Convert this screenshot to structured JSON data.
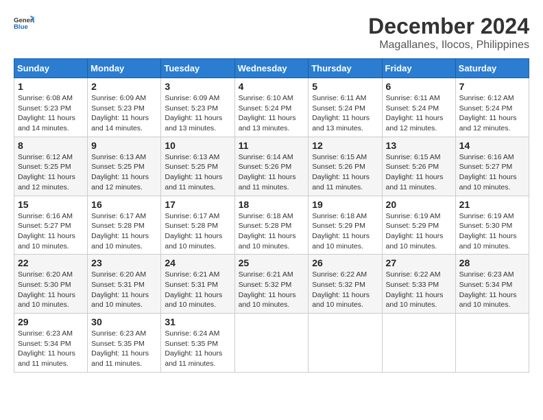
{
  "logo": {
    "text_general": "General",
    "text_blue": "Blue",
    "icon_alt": "GeneralBlue logo"
  },
  "header": {
    "month": "December 2024",
    "location": "Magallanes, Ilocos, Philippines"
  },
  "weekdays": [
    "Sunday",
    "Monday",
    "Tuesday",
    "Wednesday",
    "Thursday",
    "Friday",
    "Saturday"
  ],
  "weeks": [
    [
      {
        "day": 1,
        "sunrise": "Sunrise: 6:08 AM",
        "sunset": "Sunset: 5:23 PM",
        "daylight": "Daylight: 11 hours and 14 minutes."
      },
      {
        "day": 2,
        "sunrise": "Sunrise: 6:09 AM",
        "sunset": "Sunset: 5:23 PM",
        "daylight": "Daylight: 11 hours and 14 minutes."
      },
      {
        "day": 3,
        "sunrise": "Sunrise: 6:09 AM",
        "sunset": "Sunset: 5:23 PM",
        "daylight": "Daylight: 11 hours and 13 minutes."
      },
      {
        "day": 4,
        "sunrise": "Sunrise: 6:10 AM",
        "sunset": "Sunset: 5:24 PM",
        "daylight": "Daylight: 11 hours and 13 minutes."
      },
      {
        "day": 5,
        "sunrise": "Sunrise: 6:11 AM",
        "sunset": "Sunset: 5:24 PM",
        "daylight": "Daylight: 11 hours and 13 minutes."
      },
      {
        "day": 6,
        "sunrise": "Sunrise: 6:11 AM",
        "sunset": "Sunset: 5:24 PM",
        "daylight": "Daylight: 11 hours and 12 minutes."
      },
      {
        "day": 7,
        "sunrise": "Sunrise: 6:12 AM",
        "sunset": "Sunset: 5:24 PM",
        "daylight": "Daylight: 11 hours and 12 minutes."
      }
    ],
    [
      {
        "day": 8,
        "sunrise": "Sunrise: 6:12 AM",
        "sunset": "Sunset: 5:25 PM",
        "daylight": "Daylight: 11 hours and 12 minutes."
      },
      {
        "day": 9,
        "sunrise": "Sunrise: 6:13 AM",
        "sunset": "Sunset: 5:25 PM",
        "daylight": "Daylight: 11 hours and 12 minutes."
      },
      {
        "day": 10,
        "sunrise": "Sunrise: 6:13 AM",
        "sunset": "Sunset: 5:25 PM",
        "daylight": "Daylight: 11 hours and 11 minutes."
      },
      {
        "day": 11,
        "sunrise": "Sunrise: 6:14 AM",
        "sunset": "Sunset: 5:26 PM",
        "daylight": "Daylight: 11 hours and 11 minutes."
      },
      {
        "day": 12,
        "sunrise": "Sunrise: 6:15 AM",
        "sunset": "Sunset: 5:26 PM",
        "daylight": "Daylight: 11 hours and 11 minutes."
      },
      {
        "day": 13,
        "sunrise": "Sunrise: 6:15 AM",
        "sunset": "Sunset: 5:26 PM",
        "daylight": "Daylight: 11 hours and 11 minutes."
      },
      {
        "day": 14,
        "sunrise": "Sunrise: 6:16 AM",
        "sunset": "Sunset: 5:27 PM",
        "daylight": "Daylight: 11 hours and 10 minutes."
      }
    ],
    [
      {
        "day": 15,
        "sunrise": "Sunrise: 6:16 AM",
        "sunset": "Sunset: 5:27 PM",
        "daylight": "Daylight: 11 hours and 10 minutes."
      },
      {
        "day": 16,
        "sunrise": "Sunrise: 6:17 AM",
        "sunset": "Sunset: 5:28 PM",
        "daylight": "Daylight: 11 hours and 10 minutes."
      },
      {
        "day": 17,
        "sunrise": "Sunrise: 6:17 AM",
        "sunset": "Sunset: 5:28 PM",
        "daylight": "Daylight: 11 hours and 10 minutes."
      },
      {
        "day": 18,
        "sunrise": "Sunrise: 6:18 AM",
        "sunset": "Sunset: 5:28 PM",
        "daylight": "Daylight: 11 hours and 10 minutes."
      },
      {
        "day": 19,
        "sunrise": "Sunrise: 6:18 AM",
        "sunset": "Sunset: 5:29 PM",
        "daylight": "Daylight: 11 hours and 10 minutes."
      },
      {
        "day": 20,
        "sunrise": "Sunrise: 6:19 AM",
        "sunset": "Sunset: 5:29 PM",
        "daylight": "Daylight: 11 hours and 10 minutes."
      },
      {
        "day": 21,
        "sunrise": "Sunrise: 6:19 AM",
        "sunset": "Sunset: 5:30 PM",
        "daylight": "Daylight: 11 hours and 10 minutes."
      }
    ],
    [
      {
        "day": 22,
        "sunrise": "Sunrise: 6:20 AM",
        "sunset": "Sunset: 5:30 PM",
        "daylight": "Daylight: 11 hours and 10 minutes."
      },
      {
        "day": 23,
        "sunrise": "Sunrise: 6:20 AM",
        "sunset": "Sunset: 5:31 PM",
        "daylight": "Daylight: 11 hours and 10 minutes."
      },
      {
        "day": 24,
        "sunrise": "Sunrise: 6:21 AM",
        "sunset": "Sunset: 5:31 PM",
        "daylight": "Daylight: 11 hours and 10 minutes."
      },
      {
        "day": 25,
        "sunrise": "Sunrise: 6:21 AM",
        "sunset": "Sunset: 5:32 PM",
        "daylight": "Daylight: 11 hours and 10 minutes."
      },
      {
        "day": 26,
        "sunrise": "Sunrise: 6:22 AM",
        "sunset": "Sunset: 5:32 PM",
        "daylight": "Daylight: 11 hours and 10 minutes."
      },
      {
        "day": 27,
        "sunrise": "Sunrise: 6:22 AM",
        "sunset": "Sunset: 5:33 PM",
        "daylight": "Daylight: 11 hours and 10 minutes."
      },
      {
        "day": 28,
        "sunrise": "Sunrise: 6:23 AM",
        "sunset": "Sunset: 5:34 PM",
        "daylight": "Daylight: 11 hours and 10 minutes."
      }
    ],
    [
      {
        "day": 29,
        "sunrise": "Sunrise: 6:23 AM",
        "sunset": "Sunset: 5:34 PM",
        "daylight": "Daylight: 11 hours and 11 minutes."
      },
      {
        "day": 30,
        "sunrise": "Sunrise: 6:23 AM",
        "sunset": "Sunset: 5:35 PM",
        "daylight": "Daylight: 11 hours and 11 minutes."
      },
      {
        "day": 31,
        "sunrise": "Sunrise: 6:24 AM",
        "sunset": "Sunset: 5:35 PM",
        "daylight": "Daylight: 11 hours and 11 minutes."
      },
      null,
      null,
      null,
      null
    ]
  ]
}
